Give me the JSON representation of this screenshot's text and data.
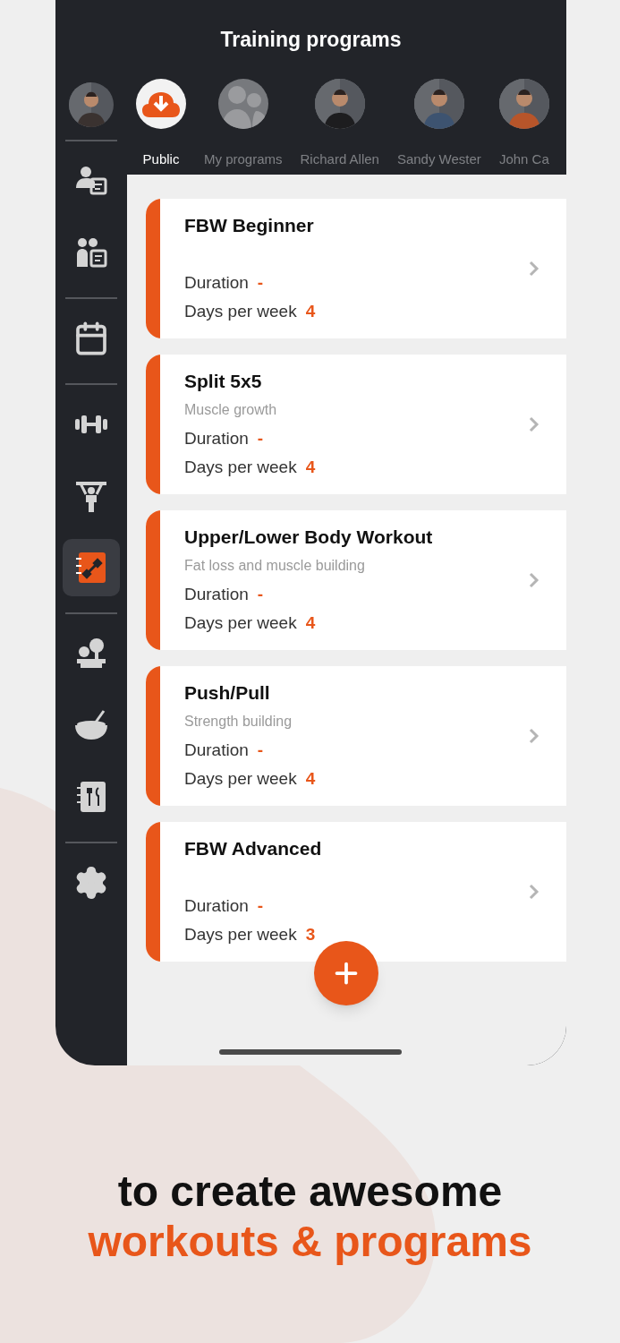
{
  "header": {
    "title": "Training programs"
  },
  "tabs": [
    {
      "label": "Public",
      "selected": true,
      "kind": "public"
    },
    {
      "label": "My programs",
      "selected": false,
      "kind": "group"
    },
    {
      "label": "Richard Allen",
      "selected": false,
      "kind": "person"
    },
    {
      "label": "Sandy Wester",
      "selected": false,
      "kind": "person"
    },
    {
      "label": "John Ca",
      "selected": false,
      "kind": "person"
    }
  ],
  "sidebar": {
    "sections": [
      [
        {
          "selected": false
        },
        {
          "selected": false
        }
      ],
      [
        {
          "selected": false
        }
      ],
      [
        {
          "selected": false
        },
        {
          "selected": false
        },
        {
          "selected": true
        }
      ],
      [
        {
          "selected": false
        },
        {
          "selected": false
        },
        {
          "selected": false
        }
      ],
      [
        {
          "selected": false
        }
      ]
    ]
  },
  "programs": [
    {
      "title": "FBW Beginner",
      "duration_label": "Duration",
      "duration": "-",
      "days_label": "Days per week",
      "days": "4"
    },
    {
      "title": "Split 5x5",
      "subtitle": "Muscle growth",
      "duration_label": "Duration",
      "duration": "-",
      "days_label": "Days per week",
      "days": "4"
    },
    {
      "title": "Upper/Lower Body Workout",
      "subtitle": "Fat loss and muscle building",
      "duration_label": "Duration",
      "duration": "-",
      "days_label": "Days per week",
      "days": "4"
    },
    {
      "title": "Push/Pull",
      "subtitle": "Strength building",
      "duration_label": "Duration",
      "duration": "-",
      "days_label": "Days per week",
      "days": "4"
    },
    {
      "title": "FBW Advanced",
      "duration_label": "Duration",
      "duration": "-",
      "days_label": "Days per week",
      "days": "3"
    }
  ],
  "tagline": {
    "line_1": "to create awesome",
    "line_2": "workouts & programs"
  }
}
